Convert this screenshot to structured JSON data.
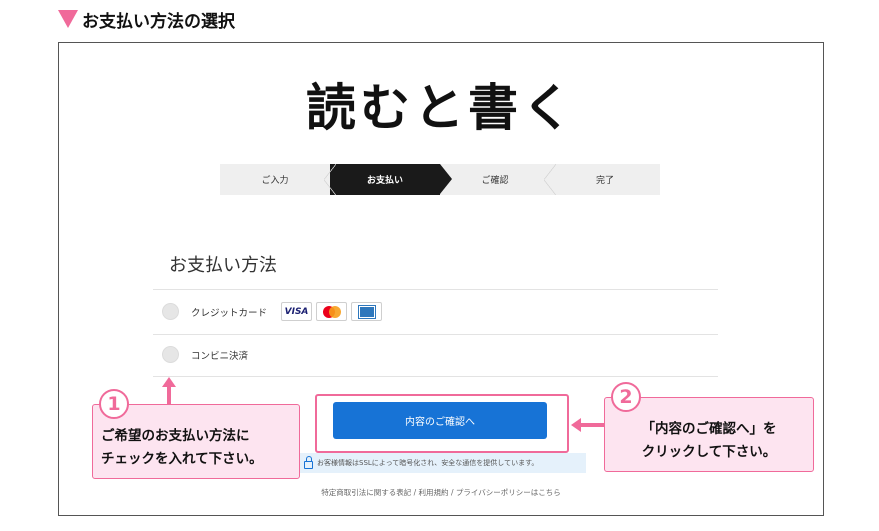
{
  "heading": {
    "title": "お支払い方法の選択"
  },
  "site": {
    "logo": "読むと書く"
  },
  "steps": [
    {
      "label": "ご入力"
    },
    {
      "label": "お支払い"
    },
    {
      "label": "ご確認"
    },
    {
      "label": "完了"
    }
  ],
  "active_step": "お支払い",
  "payment": {
    "title": "お支払い方法",
    "options": [
      {
        "label": "クレジットカード",
        "cards": [
          "VISA",
          "mastercard-icon",
          "amex-icon"
        ]
      },
      {
        "label": "コンビニ決済"
      }
    ]
  },
  "confirm_button": {
    "label": "内容のご確認へ"
  },
  "ssl_notice": "お客様情報はSSLによって暗号化され、安全な通信を提供しています。",
  "footer": "特定商取引法に関する表記 / 利用規約 / プライバシーポリシーはこちら",
  "notes": {
    "note1": {
      "number": "1",
      "line1": "ご希望のお支払い方法に",
      "line2": "チェックを入れて下さい。"
    },
    "note2": {
      "number": "2",
      "line1": "「内容のご確認へ」を",
      "line2": "クリックして下さい。"
    }
  },
  "colors": {
    "accent_pink": "#f06a9a",
    "button_blue": "#1773d6",
    "active_step": "#1a1a1a"
  }
}
